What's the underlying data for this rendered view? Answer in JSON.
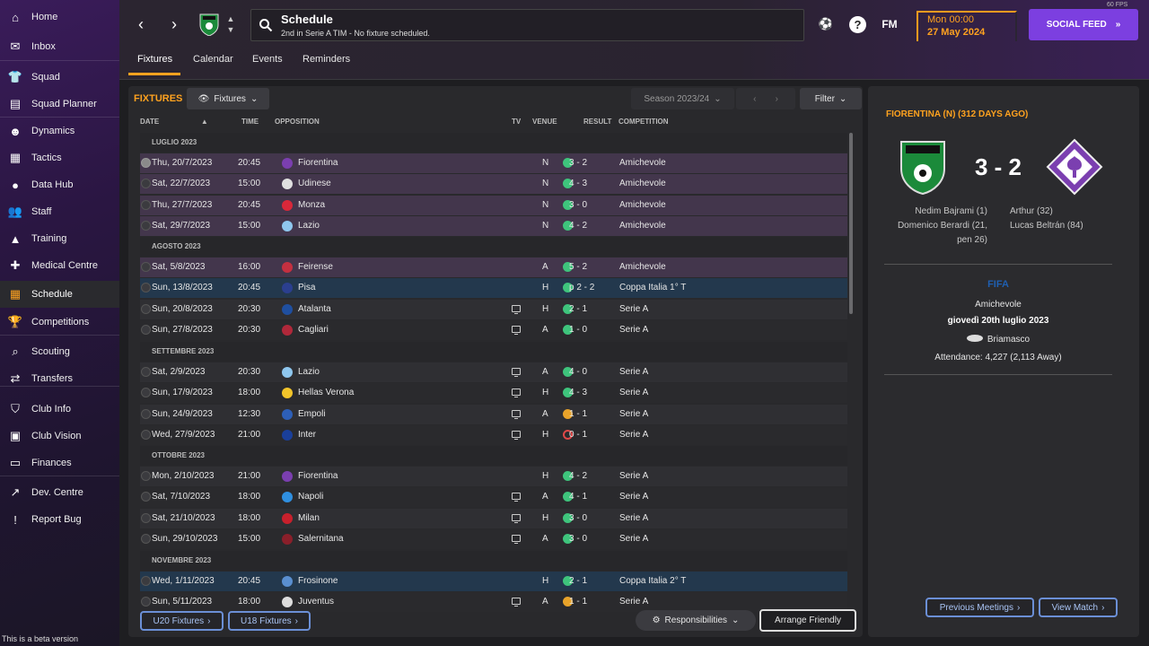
{
  "sidebar": {
    "items": [
      {
        "label": "Home",
        "icon": "home-icon"
      },
      {
        "label": "Inbox",
        "icon": "inbox-icon"
      },
      {
        "label": "Squad",
        "icon": "shirt-icon"
      },
      {
        "label": "Squad Planner",
        "icon": "clipboard-icon"
      },
      {
        "label": "Dynamics",
        "icon": "people-icon"
      },
      {
        "label": "Tactics",
        "icon": "tactics-board-icon"
      },
      {
        "label": "Data Hub",
        "icon": "globe-icon"
      },
      {
        "label": "Staff",
        "icon": "staff-icon"
      },
      {
        "label": "Training",
        "icon": "cone-icon"
      },
      {
        "label": "Medical Centre",
        "icon": "medical-kit-icon"
      },
      {
        "label": "Schedule",
        "icon": "calendar-icon"
      },
      {
        "label": "Competitions",
        "icon": "trophy-icon"
      },
      {
        "label": "Scouting",
        "icon": "magnifier-icon"
      },
      {
        "label": "Transfers",
        "icon": "transfer-arrows-icon"
      },
      {
        "label": "Club Info",
        "icon": "shield-icon"
      },
      {
        "label": "Club Vision",
        "icon": "briefcase-icon"
      },
      {
        "label": "Finances",
        "icon": "money-icon"
      },
      {
        "label": "Dev. Centre",
        "icon": "development-icon"
      },
      {
        "label": "Report Bug",
        "icon": "alert-icon"
      }
    ],
    "active": "Schedule",
    "beta_note": "This is a beta version"
  },
  "header": {
    "title": "Schedule",
    "subtitle": "2nd in Serie A TIM - No fixture scheduled.",
    "date_time": "Mon 00:00",
    "date_day": "27 May 2024",
    "social_feed": "SOCIAL FEED",
    "fm_label": "FM",
    "help_label": "?",
    "fps": "60 FPS"
  },
  "tabs": [
    "Fixtures",
    "Calendar",
    "Events",
    "Reminders"
  ],
  "fixtures": {
    "title": "FIXTURES",
    "view_button": "Fixtures",
    "season": "Season 2023/24",
    "filter": "Filter",
    "columns": {
      "date": "DATE",
      "time": "TIME",
      "opposition": "OPPOSITION",
      "tv": "TV",
      "venue": "VENUE",
      "result": "RESULT",
      "competition": "COMPETITION"
    },
    "months": [
      "LUGLIO 2023",
      "AGOSTO 2023",
      "SETTEMBRE 2023",
      "OTTOBRE 2023",
      "NOVEMBRE 2023"
    ],
    "rows": [
      {
        "date": "Thu, 20/7/2023",
        "time": "20:45",
        "opp": "Fiorentina",
        "tv": false,
        "venue": "N",
        "result": "3 - 2",
        "outcome": "win",
        "comp": "Amichevole",
        "kind": "friendly",
        "color": "#7b3fb0"
      },
      {
        "date": "Sat, 22/7/2023",
        "time": "15:00",
        "opp": "Udinese",
        "tv": false,
        "venue": "N",
        "result": "4 - 3",
        "outcome": "win",
        "comp": "Amichevole",
        "kind": "friendly",
        "color": "#e0e0e0"
      },
      {
        "date": "Thu, 27/7/2023",
        "time": "20:45",
        "opp": "Monza",
        "tv": false,
        "venue": "N",
        "result": "3 - 0",
        "outcome": "win",
        "comp": "Amichevole",
        "kind": "friendly",
        "color": "#d8283a"
      },
      {
        "date": "Sat, 29/7/2023",
        "time": "15:00",
        "opp": "Lazio",
        "tv": false,
        "venue": "N",
        "result": "4 - 2",
        "outcome": "win",
        "comp": "Amichevole",
        "kind": "friendly",
        "color": "#8fc7ee"
      },
      {
        "date": "Sat, 5/8/2023",
        "time": "16:00",
        "opp": "Feirense",
        "tv": false,
        "venue": "A",
        "result": "5 - 2",
        "outcome": "win",
        "comp": "Amichevole",
        "kind": "friendly",
        "color": "#c43040"
      },
      {
        "date": "Sun, 13/8/2023",
        "time": "20:45",
        "opp": "Pisa",
        "tv": false,
        "venue": "H",
        "result": "p 2 - 2",
        "outcome": "win",
        "comp": "Coppa Italia 1° T",
        "kind": "cup",
        "color": "#2b3f8f"
      },
      {
        "date": "Sun, 20/8/2023",
        "time": "20:30",
        "opp": "Atalanta",
        "tv": true,
        "venue": "H",
        "result": "2 - 1",
        "outcome": "win",
        "comp": "Serie A",
        "kind": "league",
        "color": "#1f4fa0"
      },
      {
        "date": "Sun, 27/8/2023",
        "time": "20:30",
        "opp": "Cagliari",
        "tv": true,
        "venue": "A",
        "result": "1 - 0",
        "outcome": "win",
        "comp": "Serie A",
        "kind": "league",
        "color": "#b0283a"
      },
      {
        "date": "Sat, 2/9/2023",
        "time": "20:30",
        "opp": "Lazio",
        "tv": true,
        "venue": "A",
        "result": "4 - 0",
        "outcome": "win",
        "comp": "Serie A",
        "kind": "league",
        "color": "#8fc7ee"
      },
      {
        "date": "Sun, 17/9/2023",
        "time": "18:00",
        "opp": "Hellas Verona",
        "tv": true,
        "venue": "H",
        "result": "4 - 3",
        "outcome": "win",
        "comp": "Serie A",
        "kind": "league",
        "color": "#f2c42a"
      },
      {
        "date": "Sun, 24/9/2023",
        "time": "12:30",
        "opp": "Empoli",
        "tv": true,
        "venue": "A",
        "result": "1 - 1",
        "outcome": "draw",
        "comp": "Serie A",
        "kind": "league",
        "color": "#2d5fb8"
      },
      {
        "date": "Wed, 27/9/2023",
        "time": "21:00",
        "opp": "Inter",
        "tv": true,
        "venue": "H",
        "result": "0 - 1",
        "outcome": "loss",
        "comp": "Serie A",
        "kind": "league",
        "color": "#1a3f9a"
      },
      {
        "date": "Mon, 2/10/2023",
        "time": "21:00",
        "opp": "Fiorentina",
        "tv": false,
        "venue": "H",
        "result": "4 - 2",
        "outcome": "win",
        "comp": "Serie A",
        "kind": "league",
        "color": "#7b3fb0"
      },
      {
        "date": "Sat, 7/10/2023",
        "time": "18:00",
        "opp": "Napoli",
        "tv": true,
        "venue": "A",
        "result": "4 - 1",
        "outcome": "win",
        "comp": "Serie A",
        "kind": "league",
        "color": "#2f8fe0"
      },
      {
        "date": "Sat, 21/10/2023",
        "time": "18:00",
        "opp": "Milan",
        "tv": true,
        "venue": "H",
        "result": "3 - 0",
        "outcome": "win",
        "comp": "Serie A",
        "kind": "league",
        "color": "#c8202c"
      },
      {
        "date": "Sun, 29/10/2023",
        "time": "15:00",
        "opp": "Salernitana",
        "tv": true,
        "venue": "A",
        "result": "3 - 0",
        "outcome": "win",
        "comp": "Serie A",
        "kind": "league",
        "color": "#8a1f2a"
      },
      {
        "date": "Wed, 1/11/2023",
        "time": "20:45",
        "opp": "Frosinone",
        "tv": false,
        "venue": "H",
        "result": "2 - 1",
        "outcome": "win",
        "comp": "Coppa Italia 2° T",
        "kind": "cup",
        "color": "#5a8fd0"
      },
      {
        "date": "Sun, 5/11/2023",
        "time": "18:00",
        "opp": "Juventus",
        "tv": true,
        "venue": "A",
        "result": "1 - 1",
        "outcome": "draw",
        "comp": "Serie A",
        "kind": "league",
        "color": "#dddddd"
      }
    ],
    "buttons": {
      "u20": "U20 Fixtures",
      "u18": "U18 Fixtures",
      "responsibilities": "Responsibilities",
      "arrange": "Arrange Friendly"
    }
  },
  "detail": {
    "title": "FIORENTINA (N) (312 DAYS AGO)",
    "score": "3 - 2",
    "home_scorers": [
      "Nedim Bajrami (1)",
      "Domenico Berardi (21,",
      "pen 26)"
    ],
    "away_scorers": [
      "Arthur (32)",
      "Lucas Beltrán (84)"
    ],
    "competition_logo": "FIFA",
    "competition": "Amichevole",
    "date": "giovedì 20th luglio 2023",
    "stadium": "Briamasco",
    "attendance": "Attendance: 4,227 (2,113 Away)",
    "buttons": {
      "previous": "Previous Meetings",
      "view": "View Match"
    },
    "home_crest_color": "#1b8a3a",
    "away_crest_color": "#7b3fb0"
  }
}
